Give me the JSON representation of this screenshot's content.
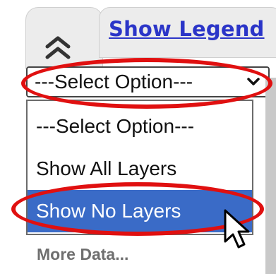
{
  "header": {
    "collapse_icon": "double-chevron-up-icon",
    "legend_link": "Show Legend"
  },
  "layer_select": {
    "value": "---Select Option---",
    "arrow_icon": "chevron-down-icon",
    "options": [
      {
        "label": "---Select Option---",
        "state": "normal"
      },
      {
        "label": "Show All Layers",
        "state": "normal"
      },
      {
        "label": "Show No Layers",
        "state": "highlighted"
      }
    ]
  },
  "footer": {
    "more_data": "More Data..."
  },
  "colors": {
    "annotation": "#e01010",
    "link": "#2b35c8",
    "highlight": "#3a6bc7"
  },
  "cursor_icon": "mouse-pointer-icon"
}
